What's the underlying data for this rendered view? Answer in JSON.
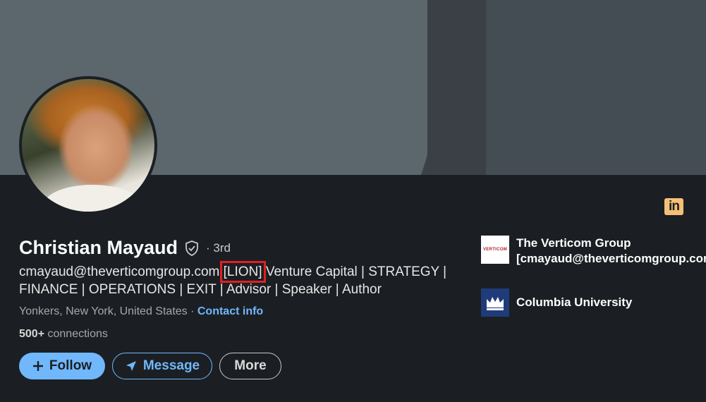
{
  "profile": {
    "name": "Christian Mayaud",
    "degree": "· 3rd",
    "headline_before": "cmayaud@theverticomgroup.com ",
    "headline_highlight": "[LION]",
    "headline_after": " Venture Capital | STRATEGY | FINANCE | OPERATIONS | EXIT | Advisor | Speaker | Author",
    "location": "Yonkers, New York, United States · ",
    "contact_info": "Contact info",
    "connections_count": "500+",
    "connections_label": " connections"
  },
  "actions": {
    "follow": "Follow",
    "message": "Message",
    "more": "More"
  },
  "affiliations": [
    {
      "name": "The Verticom Group [cmayaud@theverticomgroup.com]",
      "logo_text": "VERTICOM"
    },
    {
      "name": "Columbia University"
    }
  ],
  "badge": {
    "text": "in"
  },
  "colors": {
    "accent": "#71b7fb",
    "highlight_box": "#e02020",
    "linkedin_badge": "#f5c075"
  }
}
